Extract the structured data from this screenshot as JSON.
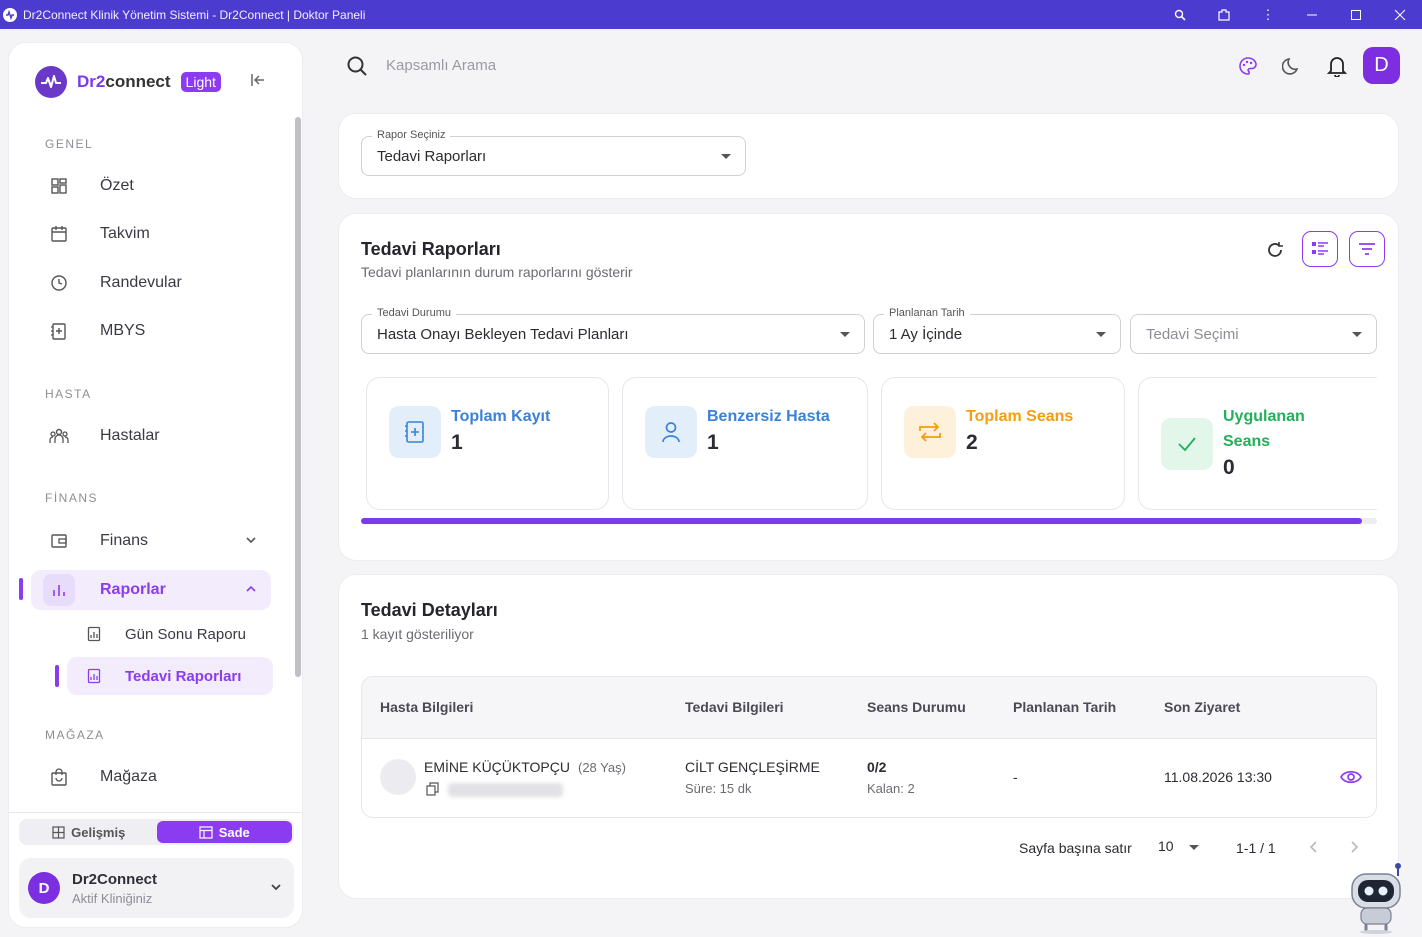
{
  "window": {
    "title": "Dr2Connect Klinik Yönetim Sistemi - Dr2Connect | Doktor Paneli"
  },
  "sidebar": {
    "brand_prefix": "Dr2",
    "brand_suffix": "connect",
    "badge": "Light",
    "sections": {
      "genel": "GENEL",
      "hasta": "HASTA",
      "finans": "FİNANS",
      "magaza": "MAĞAZA"
    },
    "items": {
      "ozet": "Özet",
      "takvim": "Takvim",
      "randevular": "Randevular",
      "mbys": "MBYS",
      "hastalar": "Hastalar",
      "finans": "Finans",
      "raporlar": "Raporlar",
      "gun_sonu": "Gün Sonu Raporu",
      "tedavi_raporlari": "Tedavi Raporları",
      "magaza": "Mağaza"
    },
    "mode": {
      "advanced": "Gelişmiş",
      "simple": "Sade",
      "selected": "Sade"
    },
    "clinic": {
      "avatar": "D",
      "name": "Dr2Connect",
      "subtitle": "Aktif Kliniğiniz"
    }
  },
  "header": {
    "search_placeholder": "Kapsamlı Arama",
    "user_initial": "D"
  },
  "report_select": {
    "label": "Rapor Seçiniz",
    "value": "Tedavi Raporları"
  },
  "report": {
    "title": "Tedavi Raporları",
    "subtitle": "Tedavi planlarının durum raporlarını gösterir",
    "filters": {
      "status_label": "Tedavi Durumu",
      "status_value": "Hasta Onayı Bekleyen Tedavi Planları",
      "date_label": "Planlanan Tarih",
      "date_value": "1 Ay İçinde",
      "treatment_placeholder": "Tedavi Seçimi"
    },
    "stats": [
      {
        "label": "Toplam Kayıt",
        "value": "1",
        "color": "#3b82d6"
      },
      {
        "label": "Benzersiz Hasta",
        "value": "1",
        "color": "#3b82d6"
      },
      {
        "label": "Toplam Seans",
        "value": "2",
        "color": "#f59e0b"
      },
      {
        "label": "Uygulanan Seans",
        "value": "0",
        "color": "#22b05a"
      }
    ],
    "progress": 0.985
  },
  "details": {
    "title": "Tedavi Detayları",
    "subtitle": "1 kayıt gösteriliyor",
    "columns": [
      "Hasta Bilgileri",
      "Tedavi Bilgileri",
      "Seans Durumu",
      "Planlanan Tarih",
      "Son Ziyaret"
    ],
    "rows": [
      {
        "patient_name": "EMİNE KÜÇÜKTOPÇU",
        "patient_age": "(28 Yaş)",
        "treatment": "CİLT GENÇLEŞİRME",
        "duration": "Süre: 15 dk",
        "sessions": "0/2",
        "remaining": "Kalan: 2",
        "planned": "-",
        "last_visit": "11.08.2026 13:30"
      }
    ]
  },
  "pagination": {
    "rows_per_page_label": "Sayfa başına satır",
    "rows_per_page": "10",
    "range": "1-1 / 1"
  },
  "colors": {
    "accent": "#8b3cf0",
    "titlebar": "#4c3bcf"
  }
}
